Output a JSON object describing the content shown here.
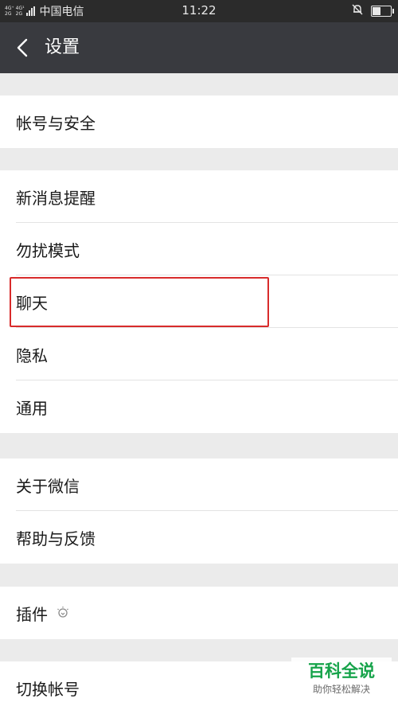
{
  "status_bar": {
    "network_top": "4G⁺",
    "network_bottom": "2G",
    "network_top2": "4G¹",
    "carrier": "中国电信",
    "time": "11:22",
    "battery_level": 0.4
  },
  "header": {
    "title": "设置"
  },
  "groups": [
    {
      "items": [
        {
          "label": "帐号与安全"
        }
      ]
    },
    {
      "items": [
        {
          "label": "新消息提醒"
        },
        {
          "label": "勿扰模式"
        },
        {
          "label": "聊天"
        },
        {
          "label": "隐私"
        },
        {
          "label": "通用"
        }
      ]
    },
    {
      "items": [
        {
          "label": "关于微信"
        },
        {
          "label": "帮助与反馈"
        }
      ]
    },
    {
      "items": [
        {
          "label": "插件"
        }
      ]
    },
    {
      "items": [
        {
          "label": "切换帐号"
        }
      ]
    }
  ],
  "watermark": {
    "title": "百科全说",
    "subtitle": "助你轻松解决"
  },
  "colors": {
    "highlight": "#d82b2b",
    "titlebar": "#393a3f",
    "watermark": "#16a34a"
  }
}
